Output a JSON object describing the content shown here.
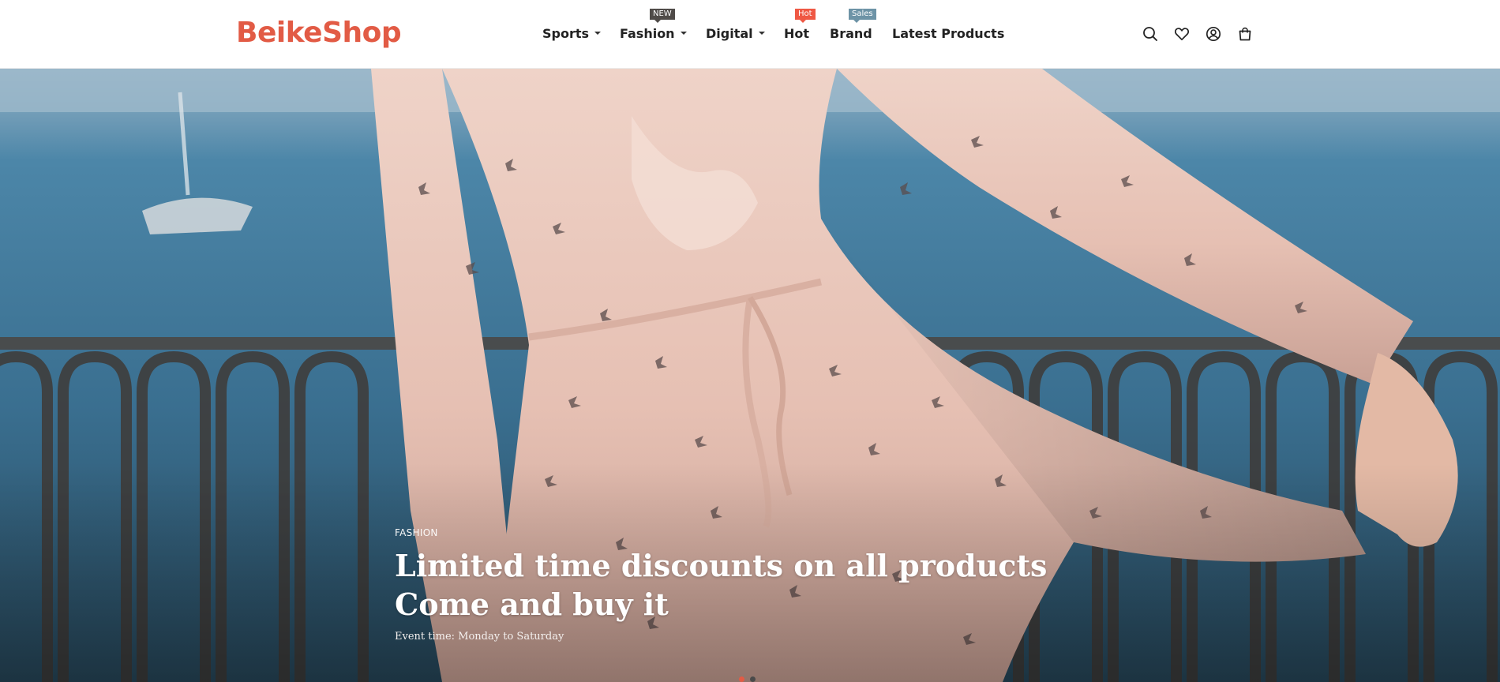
{
  "header": {
    "logo_text": "BeikeShop",
    "brand_color": "#e25b45",
    "nav": [
      {
        "label": "Sports",
        "has_dropdown": true,
        "badge": null
      },
      {
        "label": "Fashion",
        "has_dropdown": true,
        "badge": "NEW"
      },
      {
        "label": "Digital",
        "has_dropdown": true,
        "badge": null
      },
      {
        "label": "Hot",
        "has_dropdown": false,
        "badge": "Hot"
      },
      {
        "label": "Brand",
        "has_dropdown": false,
        "badge": "Sales"
      },
      {
        "label": "Latest Products",
        "has_dropdown": false,
        "badge": null
      }
    ],
    "badge_colors": {
      "NEW": "#4f4b48",
      "Hot": "#ef5844",
      "Sales": "#6d93a6"
    },
    "icons": [
      "search-icon",
      "heart-icon",
      "account-icon",
      "cart-icon"
    ]
  },
  "hero": {
    "category": "FASHION",
    "title_line1": "Limited time discounts on all products",
    "title_line2": "Come and buy it",
    "subtitle": "Event time: Monday to Saturday",
    "slide_count": 2,
    "active_slide": 1,
    "dot_active_color": "#e25b45",
    "dot_inactive_color": "#4a4a4a"
  }
}
